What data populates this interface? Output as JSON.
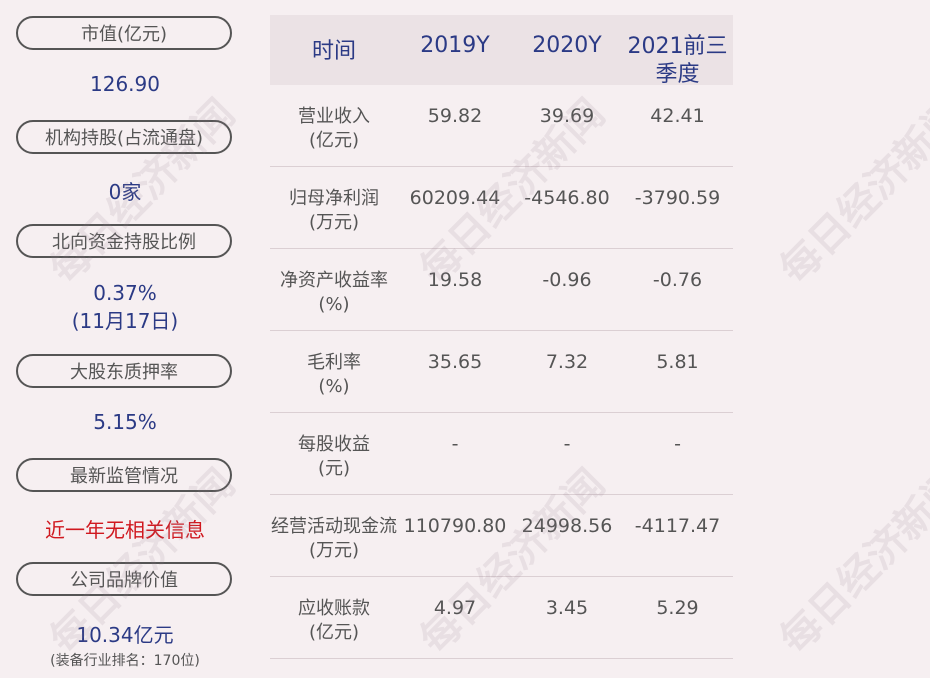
{
  "left_panel": {
    "market_cap_label": "市值(亿元)",
    "market_cap_value": "126.90",
    "institution_label": "机构持股(占流通盘)",
    "institution_value": "0家",
    "northbound_label": "北向资金持股比例",
    "northbound_value": "0.37%",
    "northbound_date": "(11月17日)",
    "pledge_label": "大股东质押率",
    "pledge_value": "5.15%",
    "regulation_label": "最新监管情况",
    "regulation_value": "近一年无相关信息",
    "brand_label": "公司品牌价值",
    "brand_value": "10.34亿元",
    "brand_note": "(装备行业排名：170位)"
  },
  "table": {
    "headers": [
      "时间",
      "2019Y",
      "2020Y",
      "2021前三季度"
    ],
    "rows": [
      {
        "label1": "营业收入",
        "label2": "(亿元)",
        "values": [
          "59.82",
          "39.69",
          "42.41"
        ]
      },
      {
        "label1": "归母净利润",
        "label2": "(万元)",
        "values": [
          "60209.44",
          "-4546.80",
          "-3790.59"
        ]
      },
      {
        "label1": "净资产收益率",
        "label2": "(%)",
        "values": [
          "19.58",
          "-0.96",
          "-0.76"
        ]
      },
      {
        "label1": "毛利率",
        "label2": "(%)",
        "values": [
          "35.65",
          "7.32",
          "5.81"
        ]
      },
      {
        "label1": "每股收益",
        "label2": "(元)",
        "values": [
          "-",
          "-",
          "-"
        ]
      },
      {
        "label1": "经营活动现金流",
        "label2": "(万元)",
        "values": [
          "110790.80",
          "24998.56",
          "-4117.47"
        ]
      },
      {
        "label1": "应收账款",
        "label2": "(亿元)",
        "values": [
          "4.97",
          "3.45",
          "5.29"
        ]
      }
    ]
  },
  "watermark": "每日经济新闻",
  "colors": {
    "background": "#f6eff1",
    "value_blue": "#2b3a85",
    "alert_red": "#d0181f",
    "header_bg": "#ebe2e5"
  }
}
